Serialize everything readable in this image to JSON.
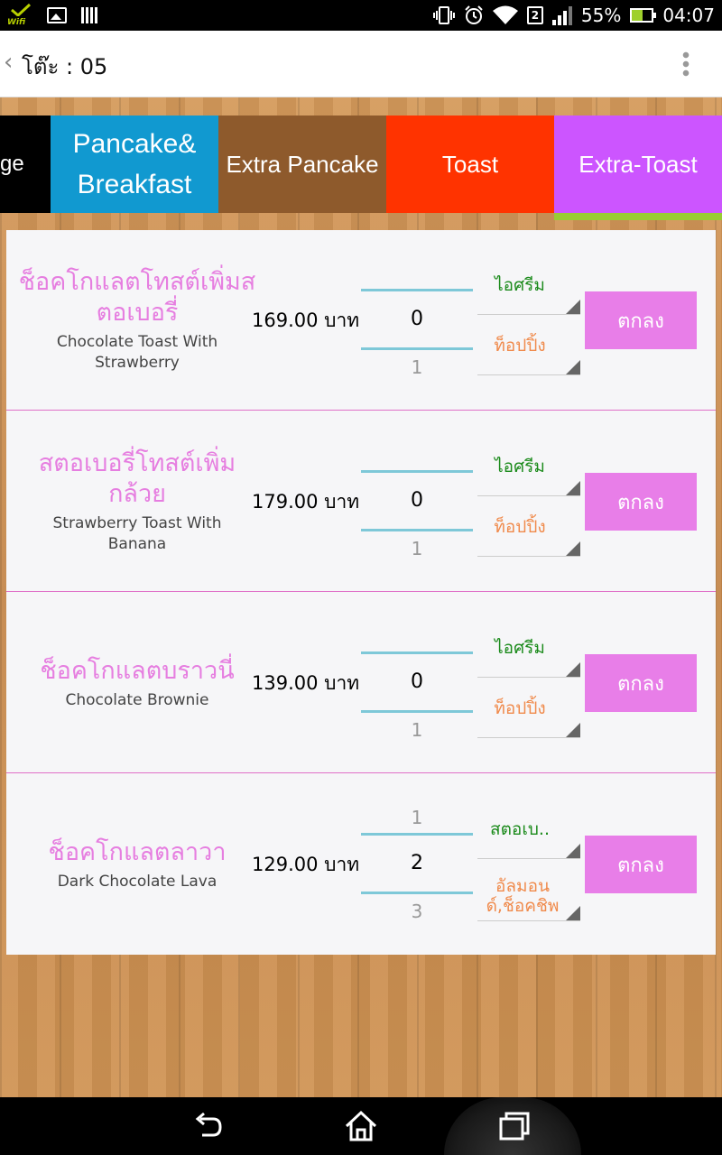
{
  "status_bar": {
    "wifi_badge": "Wifi",
    "sim_slot": "2",
    "battery": "55%",
    "time": "04:07",
    "icons": [
      "wifi-check-icon",
      "image-icon",
      "barcode-icon",
      "vibrate-icon",
      "alarm-icon",
      "wifi-icon",
      "sim-icon",
      "signal-icon",
      "battery-charging-icon"
    ]
  },
  "action_bar": {
    "back_icon": "chevron-left-icon",
    "title": "โต๊ะ : 05",
    "overflow_icon": "overflow-menu-icon"
  },
  "categories": {
    "tabs": [
      {
        "label": "ge",
        "color": "#000000"
      },
      {
        "label_line1": "Pancake&",
        "label_line2": "Breakfast",
        "color": "#1199d0"
      },
      {
        "label": "Extra Pancake",
        "color": "#8e5a2c"
      },
      {
        "label": "Toast",
        "color": "#ff3300"
      },
      {
        "label": "Extra-Toast",
        "color": "#cc55ff",
        "selected": true
      }
    ],
    "indicator_color": "#99cc33"
  },
  "menu": {
    "items": [
      {
        "name_th": "ช็อคโกแลตโทสต์เพิ่มสตอเบอรี่",
        "name_en": "Chocolate Toast With Strawberry",
        "price": "169.00 บาท",
        "qty_current": "0",
        "qty_next": "1",
        "option1": "ไอศรีม",
        "option2": "ท็อปปิ้ง",
        "ok_label": "ตกลง"
      },
      {
        "name_th": "สตอเบอรี่โทสต์เพิ่มกล้วย",
        "name_en": "Strawberry Toast With Banana",
        "price": "179.00 บาท",
        "qty_current": "0",
        "qty_next": "1",
        "option1": "ไอศรีม",
        "option2": "ท็อปปิ้ง",
        "ok_label": "ตกลง"
      },
      {
        "name_th": "ช็อคโกแลตบราวนี่",
        "name_en": "Chocolate Brownie",
        "price": "139.00 บาท",
        "qty_current": "0",
        "qty_next": "1",
        "option1": "ไอศรีม",
        "option2": "ท็อปปิ้ง",
        "ok_label": "ตกลง"
      },
      {
        "name_th": "ช็อคโกแลตลาวา",
        "name_en": "Dark Chocolate Lava",
        "price": "129.00 บาท",
        "qty_prev": "1",
        "qty_current": "2",
        "qty_next": "3",
        "option1": "สตอเบ..",
        "option2": "อัลมอนด์,ช็อคชิพ",
        "ok_label": "ตกลง"
      }
    ],
    "colors": {
      "thai_name": "#e67ee0",
      "option1": "#1a8a1a",
      "option2": "#f08a4b",
      "ok_button": "#e87ee8",
      "divider": "#e070c8"
    }
  },
  "nav_bar": {
    "icons": [
      "back-icon",
      "home-icon",
      "recent-apps-icon"
    ]
  }
}
